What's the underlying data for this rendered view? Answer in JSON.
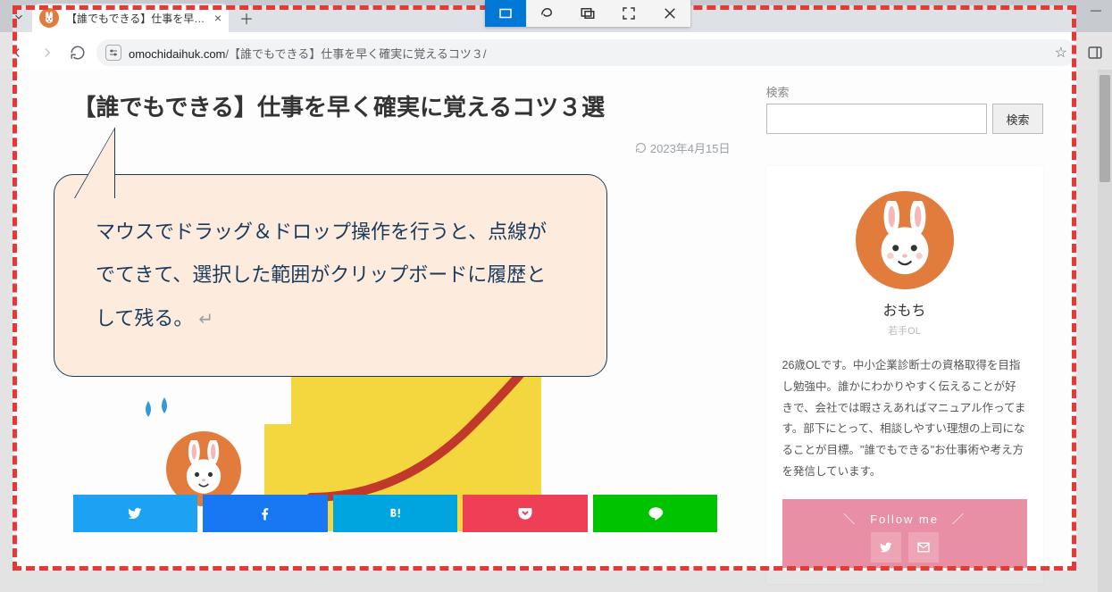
{
  "browser": {
    "tab_title": "【誰でもできる】仕事を早く確実に覚",
    "url_domain": "omochidaihuk.com",
    "url_path": "/【誰でもできる】仕事を早く確実に覚えるコツ３/"
  },
  "article": {
    "title": "【誰でもできる】仕事を早く確実に覚えるコツ３選",
    "date": "2023年4月15日"
  },
  "sidebar": {
    "search_label": "検索",
    "search_button": "検索",
    "profile_name": "おもち",
    "profile_sub": "若手OL",
    "profile_bio": "26歳OLです。中小企業診断士の資格取得を目指し勉強中。誰かにわかりやすく伝えることが好きで、会社では暇さえあればマニュアル作ってます。部下にとって、相談しやすい理想の上司になることが目標。\"誰でもできる\"お仕事術や考え方を発信しています。",
    "follow_label": "＼　Follow me　／"
  },
  "callout": {
    "text": "マウスでドラッグ＆ドロップ操作を行うと、点線がでてきて、選択した範囲がクリップボードに履歴として残る。"
  },
  "colors": {
    "accent": "#e27c3d",
    "selection": "#e53935",
    "pink": "#e98fa3"
  }
}
